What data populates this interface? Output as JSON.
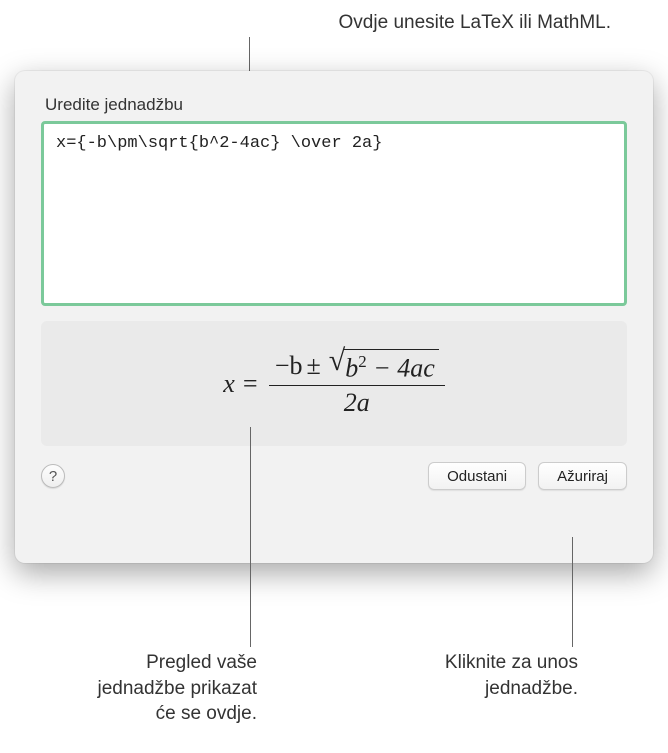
{
  "callouts": {
    "top": "Ovdje unesite LaTeX ili MathML.",
    "preview": "Pregled vaše jednadžbe prikazat će se ovdje.",
    "button": "Kliknite za unos jednadžbe."
  },
  "dialog": {
    "title": "Uredite jednadžbu",
    "input_value": "x={-b\\pm\\sqrt{b^2-4ac} \\over 2a}",
    "help_label": "?",
    "cancel_label": "Odustani",
    "update_label": "Ažuriraj"
  },
  "equation_preview": {
    "lhs": "x =",
    "numerator_prefix": "−b",
    "plus_minus": "±",
    "radicand": "b",
    "radicand_sup": "2",
    "radicand_suffix": " − 4ac",
    "denominator": "2a"
  }
}
